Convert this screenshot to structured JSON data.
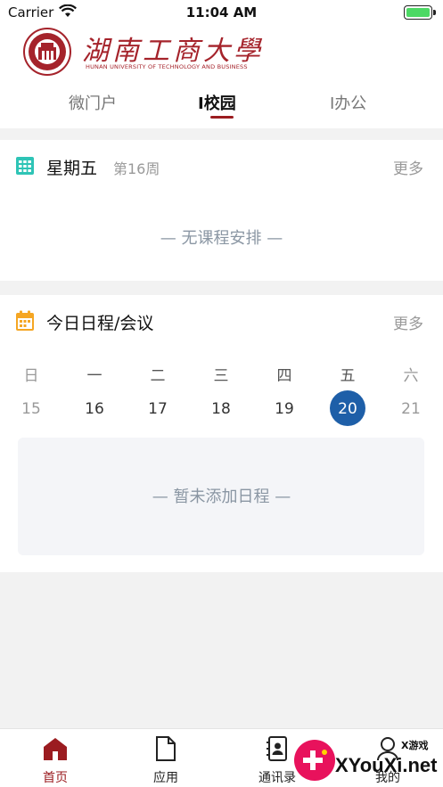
{
  "status": {
    "carrier": "Carrier",
    "time": "11:04 AM"
  },
  "brand": {
    "name": "湖南工商大學",
    "sub": "HUNAN UNIVERSITY OF TECHNOLOGY AND BUSINESS",
    "colors": {
      "primary": "#9b1c20",
      "accent": "#1e5fa8"
    }
  },
  "tabs": [
    {
      "label": "微门户",
      "active": false
    },
    {
      "label": "I校园",
      "active": true
    },
    {
      "label": "I办公",
      "active": false
    }
  ],
  "today_card": {
    "icon": "calendar-grid-icon",
    "weekday": "星期五",
    "week_no": "第16周",
    "more": "更多",
    "empty": "—  无课程安排  —"
  },
  "schedule_card": {
    "icon": "calendar-icon",
    "title": "今日日程/会议",
    "more": "更多",
    "weekdays": [
      "日",
      "一",
      "二",
      "三",
      "四",
      "五",
      "六"
    ],
    "dates": [
      "15",
      "16",
      "17",
      "18",
      "19",
      "20",
      "21"
    ],
    "selected_index": 5,
    "empty": "—  暂未添加日程  —"
  },
  "tabbar": [
    {
      "label": "首页",
      "icon": "home-icon",
      "active": true
    },
    {
      "label": "应用",
      "icon": "document-icon",
      "active": false
    },
    {
      "label": "通讯录",
      "icon": "contacts-icon",
      "active": false
    },
    {
      "label": "我的",
      "icon": "user-icon",
      "active": false
    }
  ],
  "ad": {
    "text": "XYouXi.net",
    "small": "X游戏"
  }
}
